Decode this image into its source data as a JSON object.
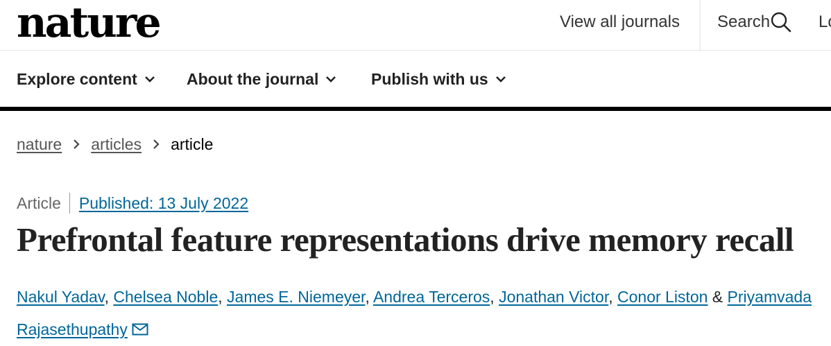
{
  "header": {
    "logo": "nature",
    "view_journals": "View all journals",
    "search": "Search",
    "login": "Lo"
  },
  "nav": {
    "items": [
      {
        "label": "Explore content"
      },
      {
        "label": "About the journal"
      },
      {
        "label": "Publish with us"
      }
    ]
  },
  "breadcrumb": {
    "items": [
      "nature",
      "articles",
      "article"
    ]
  },
  "article": {
    "type": "Article",
    "published": "Published: 13 July 2022",
    "title": "Prefrontal feature representations drive memory recall",
    "authors": [
      "Nakul Yadav",
      "Chelsea Noble",
      "James E. Niemeyer",
      "Andrea Terceros",
      "Jonathan Victor",
      "Conor Liston",
      "Priyamvada Rajasethupathy"
    ],
    "separator": ", ",
    "ampersand": " & "
  },
  "colors": {
    "link": "#006699",
    "text": "#222222",
    "rule": "#000000"
  },
  "icons": [
    "search-icon",
    "chevron-down-icon",
    "chevron-right-icon",
    "mail-icon"
  ]
}
